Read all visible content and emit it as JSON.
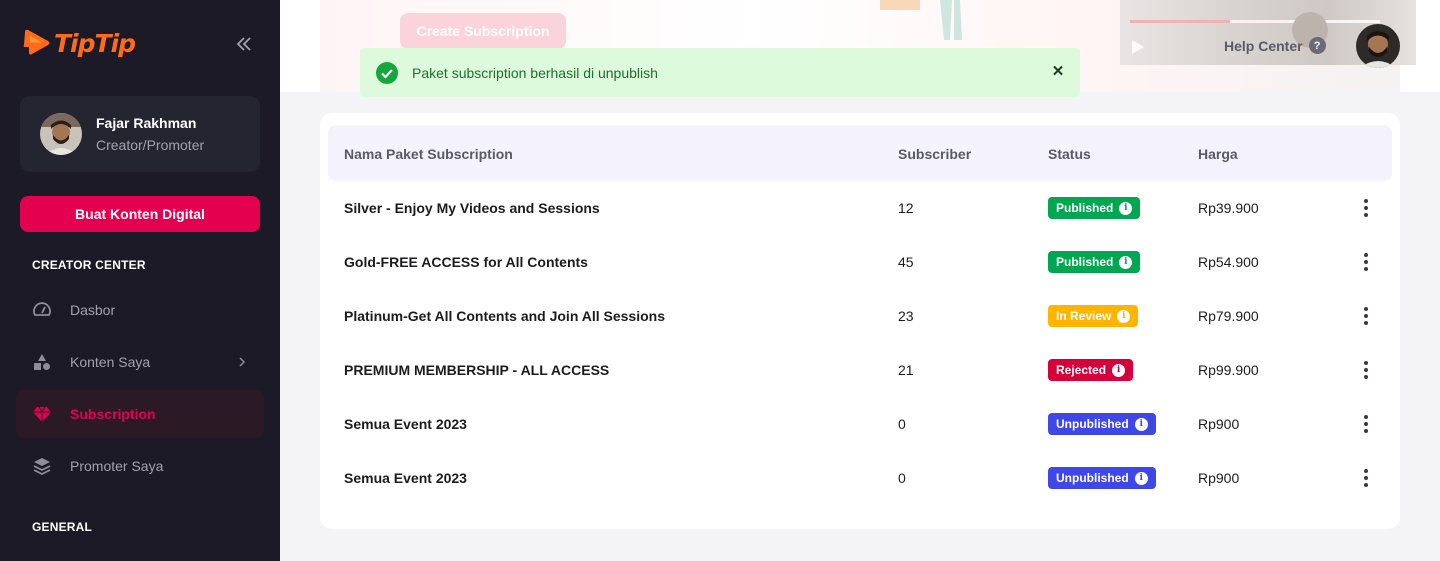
{
  "brand": {
    "name": "TipTip",
    "accent": "#e3004f",
    "logo_color": "#ff6b1a"
  },
  "sidebar": {
    "collapse_icon": "double-chevron-left-icon",
    "profile": {
      "name": "Fajar Rakhman",
      "role": "Creator/Promoter"
    },
    "primary_button": "Buat Konten Digital",
    "sections": [
      {
        "label": "CREATOR CENTER"
      },
      {
        "label": "GENERAL"
      }
    ],
    "items": [
      {
        "label": "Dasbor",
        "icon": "speedometer-icon"
      },
      {
        "label": "Konten Saya",
        "icon": "shapes-icon"
      },
      {
        "label": "Subscription",
        "icon": "diamond-icon",
        "active": true
      },
      {
        "label": "Promoter Saya",
        "icon": "layers-icon"
      }
    ]
  },
  "banner": {
    "button_label": "Create Subscription"
  },
  "header": {
    "help_label": "Help Center",
    "help_icon": "question-circle-icon"
  },
  "toast": {
    "message": "Paket subscription berhasil di unpublish",
    "color": "#defadd"
  },
  "table": {
    "headers": [
      "Nama Paket Subscription",
      "Subscriber",
      "Status",
      "Harga"
    ],
    "rows": [
      {
        "name": "Silver - Enjoy My Videos and Sessions",
        "subscribers": "12",
        "status": "Published",
        "status_color": "#00a651",
        "price": "Rp39.900"
      },
      {
        "name": "Gold-FREE ACCESS for All Contents",
        "subscribers": "45",
        "status": "Published",
        "status_color": "#00a651",
        "price": "Rp54.900"
      },
      {
        "name": "Platinum-Get All Contents and Join All Sessions",
        "subscribers": "23",
        "status": "In Review",
        "status_color": "#ffb400",
        "price": "Rp79.900"
      },
      {
        "name": "PREMIUM MEMBERSHIP - ALL ACCESS",
        "subscribers": "21",
        "status": "Rejected",
        "status_color": "#d6003d",
        "price": "Rp99.900"
      },
      {
        "name": "Semua Event 2023",
        "subscribers": "0",
        "status": "Unpublished",
        "status_color": "#3f47e6",
        "price": "Rp900"
      },
      {
        "name": "Semua Event 2023",
        "subscribers": "0",
        "status": "Unpublished",
        "status_color": "#3f47e6",
        "price": "Rp900"
      }
    ]
  }
}
